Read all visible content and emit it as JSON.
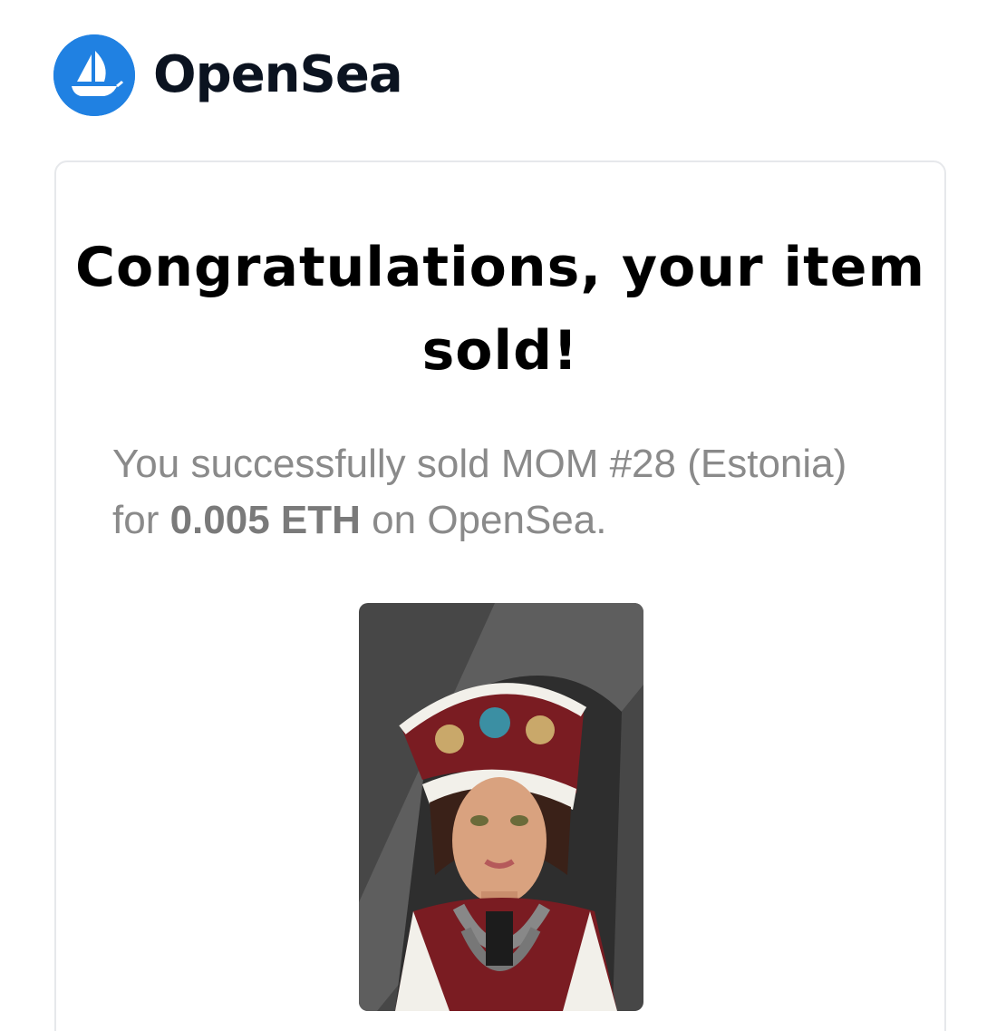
{
  "brand": {
    "name": "OpenSea",
    "logo_icon": "opensea-ship-icon",
    "logo_color": "#2081e2"
  },
  "email": {
    "title": "Congratulations, your item sold!",
    "message_prefix": "You successfully sold MOM #28 (Estonia) for ",
    "amount": "0.005 ETH",
    "message_suffix": " on OpenSea."
  },
  "nft": {
    "image_icon": "nft-portrait-image",
    "background": "#4a4a4a"
  }
}
